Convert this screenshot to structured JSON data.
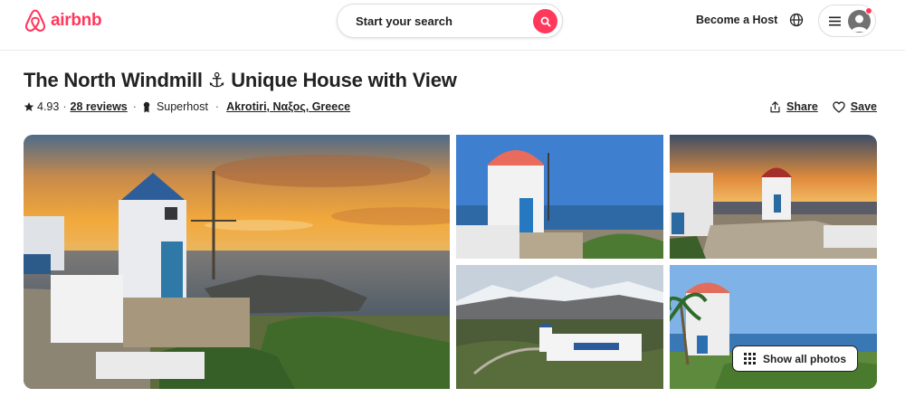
{
  "brand": {
    "name": "airbnb",
    "color": "#ff385c"
  },
  "header": {
    "search_label": "Start your search",
    "become_host": "Become a Host"
  },
  "listing": {
    "title": "The North Windmill ⚓ Unique House with View",
    "rating": "4.93",
    "reviews": "28 reviews",
    "superhost": "Superhost",
    "location": "Akrotiri, Ναξος, Greece"
  },
  "actions": {
    "share": "Share",
    "save": "Save"
  },
  "gallery": {
    "show_all": "Show all photos",
    "photos": [
      "windmill-sunset-main",
      "windmill-blue-sky",
      "windmill-terrace-sunset",
      "house-mountain-view",
      "windmill-palm"
    ]
  },
  "icons": [
    "airbnb-logo-icon",
    "search-icon",
    "globe-icon",
    "hamburger-menu-icon",
    "avatar-icon",
    "star-icon",
    "superhost-medal-icon",
    "share-icon",
    "heart-icon",
    "grid-icon"
  ]
}
